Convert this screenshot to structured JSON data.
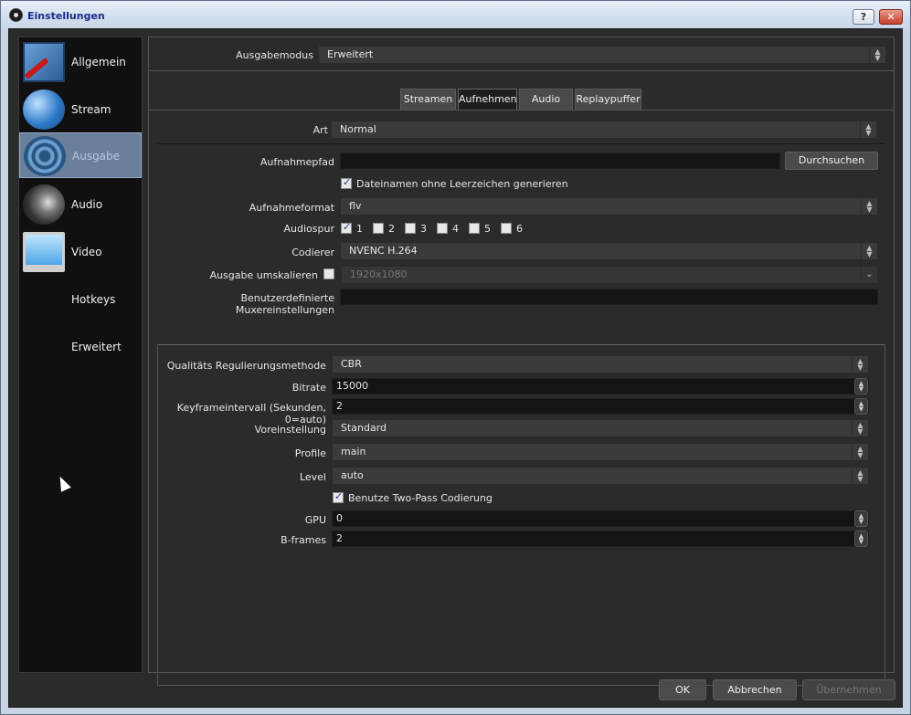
{
  "window": {
    "title": "Einstellungen",
    "help_label": "?",
    "close_label": "✕"
  },
  "sidebar": {
    "items": [
      {
        "label": "Allgemein",
        "icon": "general-icon"
      },
      {
        "label": "Stream",
        "icon": "globe-icon"
      },
      {
        "label": "Ausgabe",
        "icon": "broadcast-icon",
        "active": true
      },
      {
        "label": "Audio",
        "icon": "speaker-icon"
      },
      {
        "label": "Video",
        "icon": "monitor-icon"
      },
      {
        "label": "Hotkeys",
        "icon": "keyboard-icon"
      },
      {
        "label": "Erweitert",
        "icon": "gears-icon"
      }
    ]
  },
  "output_mode": {
    "label": "Ausgabemodus",
    "value": "Erweitert"
  },
  "tabs": [
    "Streamen",
    "Aufnehmen",
    "Audio",
    "Replaypuffer"
  ],
  "active_tab": "Aufnehmen",
  "recording": {
    "type": {
      "label": "Art",
      "value": "Normal"
    },
    "path": {
      "label": "Aufnahmepfad",
      "value": "",
      "browse_label": "Durchsuchen"
    },
    "no_spaces": {
      "label": "Dateinamen ohne Leerzeichen generieren",
      "checked": true
    },
    "format": {
      "label": "Aufnahmeformat",
      "value": "flv"
    },
    "tracks": {
      "label": "Audiospur",
      "items": [
        {
          "label": "1",
          "checked": true
        },
        {
          "label": "2",
          "checked": false
        },
        {
          "label": "3",
          "checked": false
        },
        {
          "label": "4",
          "checked": false
        },
        {
          "label": "5",
          "checked": false
        },
        {
          "label": "6",
          "checked": false
        }
      ]
    },
    "encoder": {
      "label": "Codierer",
      "value": "NVENC H.264"
    },
    "rescale": {
      "label": "Ausgabe umskalieren",
      "checked": false,
      "value": "1920x1080"
    },
    "muxer": {
      "label": "Benutzerdefinierte Muxereinstellungen",
      "value": ""
    }
  },
  "encoder_settings": {
    "rate_control": {
      "label": "Qualitäts Regulierungsmethode",
      "value": "CBR"
    },
    "bitrate": {
      "label": "Bitrate",
      "value": "15000"
    },
    "keyframe": {
      "label": "Keyframeintervall (Sekunden, 0=auto)",
      "value": "2"
    },
    "preset": {
      "label": "Voreinstellung",
      "value": "Standard"
    },
    "profile": {
      "label": "Profile",
      "value": "main"
    },
    "level": {
      "label": "Level",
      "value": "auto"
    },
    "two_pass": {
      "label": "Benutze Two-Pass Codierung",
      "checked": true
    },
    "gpu": {
      "label": "GPU",
      "value": "0"
    },
    "bframes": {
      "label": "B-frames",
      "value": "2"
    }
  },
  "footer": {
    "ok": "OK",
    "cancel": "Abbrechen",
    "apply": "Übernehmen"
  }
}
